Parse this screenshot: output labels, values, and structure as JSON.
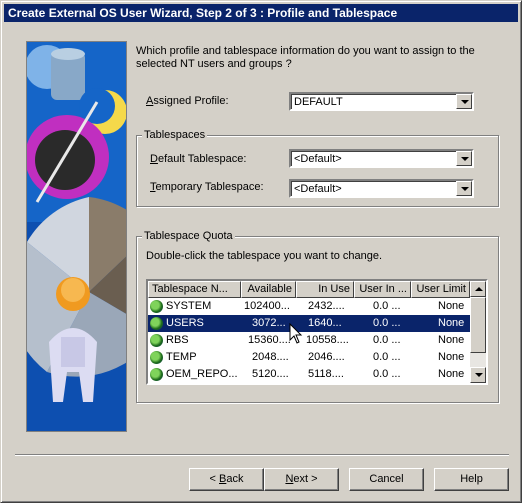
{
  "window": {
    "title": "Create External OS User Wizard, Step 2 of 3 : Profile and Tablespace"
  },
  "question": {
    "line1": "Which profile and tablespace information do you want to assign to the",
    "line2": "selected NT users and groups ?"
  },
  "profile": {
    "label_prefix": "",
    "label_mnemonic": "A",
    "label_rest": "ssigned Profile:",
    "value": "DEFAULT"
  },
  "tablespaces": {
    "group_label": "Tablespaces",
    "default": {
      "label_mnemonic": "D",
      "label_rest": "efault Tablespace:",
      "value": "<Default>"
    },
    "temporary": {
      "label_mnemonic": "T",
      "label_rest": "emporary Tablespace:",
      "value": "<Default>"
    }
  },
  "quota": {
    "group_label": "Tablespace Quota",
    "instruction": "Double-click the tablespace you want to change.",
    "columns": [
      "Tablespace N...",
      "Available",
      "In Use",
      "User In ...",
      "User Limit"
    ],
    "rows": [
      {
        "name": "SYSTEM",
        "available": "102400...",
        "in_use": "2432....",
        "user_in": "0.0 ...",
        "limit": "None",
        "selected": false
      },
      {
        "name": "USERS",
        "available": "3072...",
        "in_use": "1640...",
        "user_in": "0.0 ...",
        "limit": "None",
        "selected": true
      },
      {
        "name": "RBS",
        "available": "15360....",
        "in_use": "10558....",
        "user_in": "0.0 ...",
        "limit": "None",
        "selected": false
      },
      {
        "name": "TEMP",
        "available": "2048....",
        "in_use": "2046....",
        "user_in": "0.0 ...",
        "limit": "None",
        "selected": false
      },
      {
        "name": "OEM_REPO...",
        "available": "5120....",
        "in_use": "5118....",
        "user_in": "0.0 ...",
        "limit": "None",
        "selected": false
      }
    ]
  },
  "buttons": {
    "back_prefix": "< ",
    "back_mnemonic": "B",
    "back_rest": "ack",
    "next_mnemonic": "N",
    "next_rest": "ext >",
    "cancel": "Cancel",
    "help": "Help"
  },
  "colors": {
    "titlebar": "#0a246a",
    "face": "#d4d0c8",
    "selection": "#0a246a"
  }
}
